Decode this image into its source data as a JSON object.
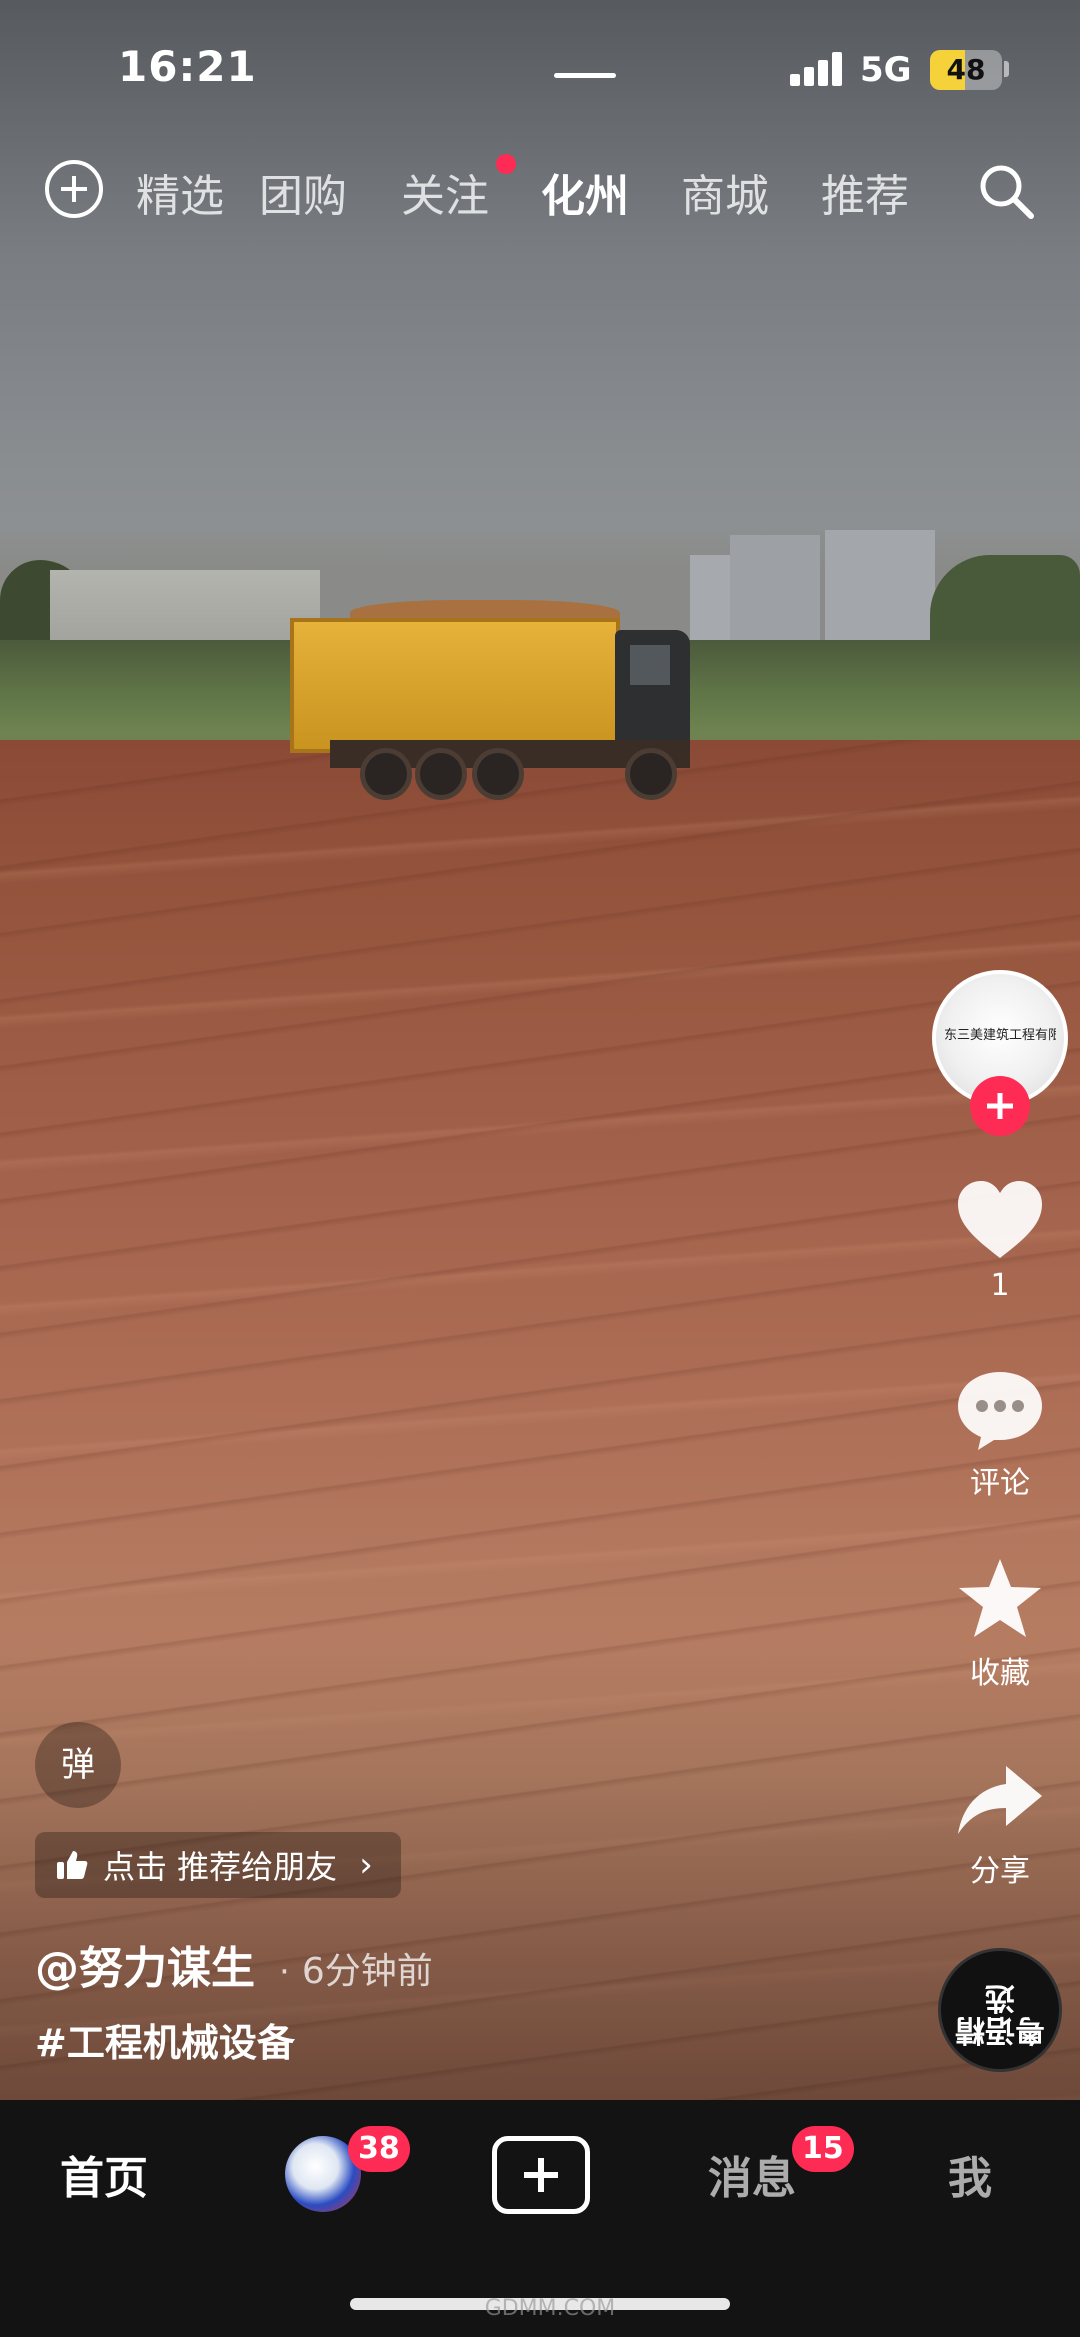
{
  "status_bar": {
    "time": "16:21",
    "network": "5G",
    "battery": "48",
    "battery_level": 0.48
  },
  "top_nav": {
    "tabs": [
      {
        "label": "精选"
      },
      {
        "label": "团购"
      },
      {
        "label": "关注"
      },
      {
        "label": "化州",
        "active": true
      },
      {
        "label": "商城"
      },
      {
        "label": "推荐"
      }
    ]
  },
  "video": {
    "author_avatar_text": "东三美建筑工程有限公",
    "like_count": "1",
    "comment_label": "评论",
    "favorite_label": "收藏",
    "share_label": "分享",
    "album_badge": "粤语精选",
    "danmu_label": "弹",
    "recommend_label": "点击 推荐给朋友",
    "author": "@努力谋生",
    "separator": "·",
    "time_ago": "6分钟前",
    "hashtag": "#工程机械设备"
  },
  "bottom_nav": {
    "home": "首页",
    "friends_badge": "38",
    "messages": "消息",
    "messages_badge": "15",
    "me": "我"
  },
  "watermark": "GDMM.COM",
  "colors": {
    "accent": "#fe2c55",
    "battery": "#f5d13a",
    "bottom_bar": "#131313"
  }
}
